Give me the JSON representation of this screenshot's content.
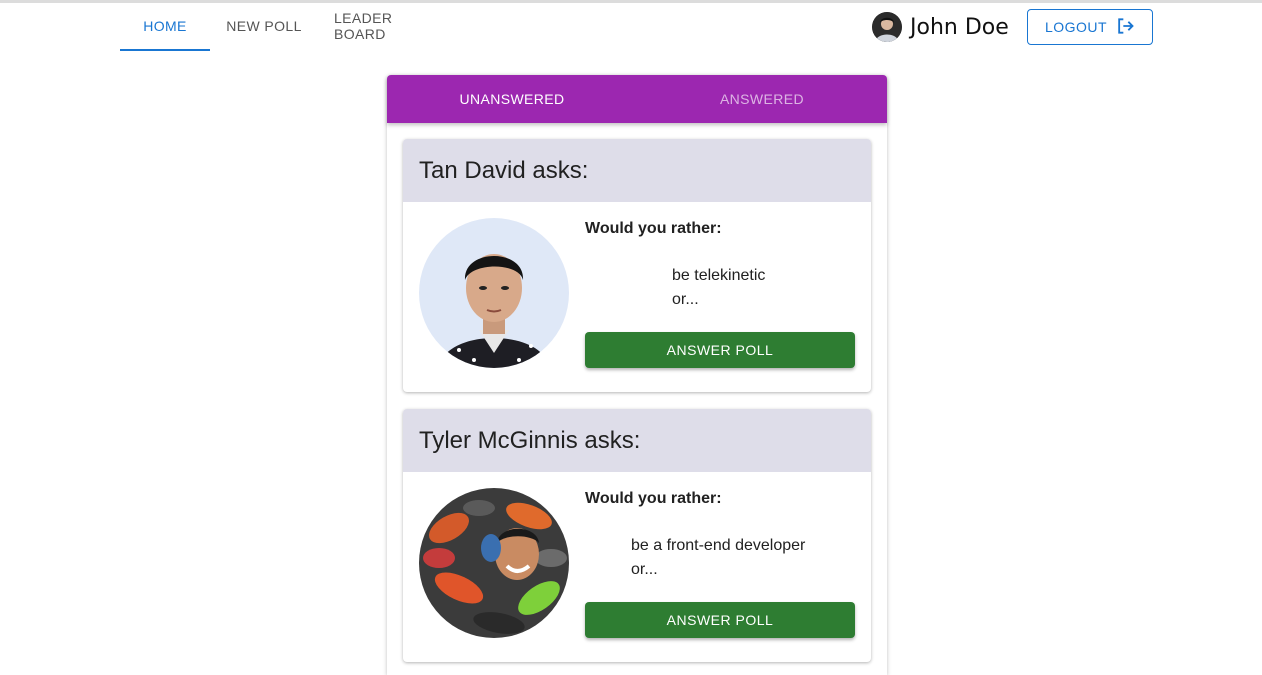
{
  "nav": {
    "tabs": [
      {
        "label": "HOME",
        "active": true
      },
      {
        "label": "NEW POLL",
        "active": false
      },
      {
        "label": "LEADER BOARD",
        "active": false
      }
    ]
  },
  "user": {
    "name": "John Doe",
    "avatar_icon": "user-avatar"
  },
  "logout": {
    "label": "LOGOUT",
    "icon": "logout-icon"
  },
  "question_tabs": [
    {
      "label": "UNANSWERED",
      "active": true
    },
    {
      "label": "ANSWERED",
      "active": false
    }
  ],
  "questions": [
    {
      "author_heading": "Tan David asks:",
      "prompt": "Would you rather:",
      "option_one": "be telekinetic",
      "or_text": "or...",
      "button_label": "ANSWER POLL"
    },
    {
      "author_heading": "Tyler McGinnis asks:",
      "prompt": "Would you rather:",
      "option_one": "be a front-end developer",
      "or_text": "or...",
      "button_label": "ANSWER POLL"
    }
  ],
  "colors": {
    "primary": "#1976d2",
    "tab_bar": "#9c27b0",
    "card_header": "#dedde9",
    "answer_button": "#2e7d32"
  }
}
